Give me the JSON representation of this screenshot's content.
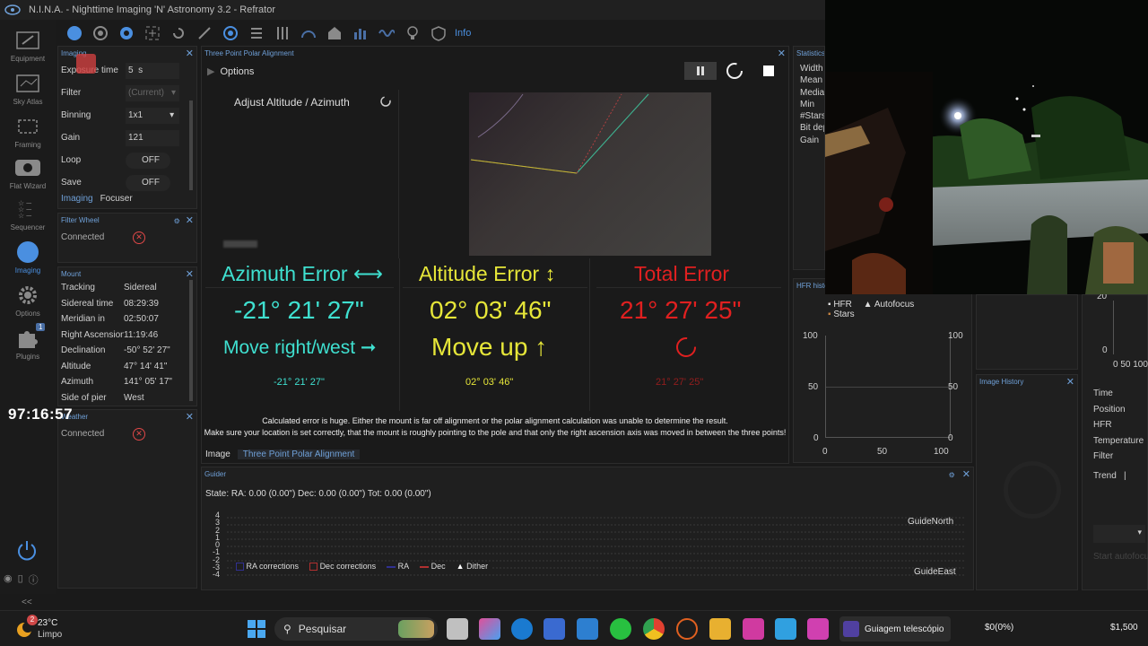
{
  "window": {
    "title": "N.I.N.A. - Nighttime Imaging 'N' Astronomy 3.2  -  Refrator"
  },
  "nav": [
    {
      "label": "Equipment"
    },
    {
      "label": "Sky Atlas"
    },
    {
      "label": "Framing"
    },
    {
      "label": "Flat Wizard"
    },
    {
      "label": "Sequencer"
    },
    {
      "label": "Imaging"
    },
    {
      "label": "Options"
    },
    {
      "label": "Plugins",
      "badge": "1"
    }
  ],
  "toolbar": {
    "info_label": "Info"
  },
  "imaging_panel": {
    "title": "Imaging",
    "rows": [
      {
        "label": "Exposure time",
        "value": "5",
        "unit": "s"
      },
      {
        "label": "Filter",
        "value": "(Current)"
      },
      {
        "label": "Binning",
        "value": "1x1"
      },
      {
        "label": "Gain",
        "value": "121"
      },
      {
        "label": "Loop",
        "value": "OFF"
      },
      {
        "label": "Save",
        "value": "OFF"
      }
    ],
    "tabs": [
      "Imaging",
      "Focuser"
    ]
  },
  "filter_wheel": {
    "title": "Filter Wheel",
    "status": "Connected"
  },
  "mount": {
    "title": "Mount",
    "rows": [
      {
        "k": "Tracking",
        "v": "Sidereal"
      },
      {
        "k": "Sidereal time",
        "v": "08:29:39"
      },
      {
        "k": "Meridian in",
        "v": "02:50:07"
      },
      {
        "k": "Right Ascension",
        "v": "11:19:46"
      },
      {
        "k": "Declination",
        "v": "-50° 52' 27\""
      },
      {
        "k": "Altitude",
        "v": "47° 14' 41\""
      },
      {
        "k": "Azimuth",
        "v": "141° 05' 17\""
      },
      {
        "k": "Side of pier",
        "v": "West"
      }
    ]
  },
  "weather": {
    "title": "Weather",
    "status": "Connected"
  },
  "timer": "97:16:57",
  "tppa": {
    "panel_title": "Three Point Polar Alignment",
    "options_label": "Options",
    "step_label": "Adjust Altitude / Azimuth",
    "azimuth": {
      "title": "Azimuth Error ⟷",
      "value": "-21° 21' 27\"",
      "move": "Move right/west ➞",
      "small": "-21° 21' 27\""
    },
    "altitude": {
      "title": "Altitude Error ↕",
      "value": "02° 03' 46\"",
      "move": "Move up ↑",
      "small": "02° 03' 46\""
    },
    "total": {
      "title": "Total Error",
      "value": "21° 27' 25\"",
      "small": "21° 27' 25\""
    },
    "message1": "Calculated error is huge. Either the mount is far off alignment or the polar alignment calculation was unable to determine the result.",
    "message2": "Make sure your location is set correctly, that the mount is roughly pointing to the pole and that only the right ascension axis was moved in between the three points!",
    "tabs": [
      "Image",
      "Three Point Polar Alignment"
    ]
  },
  "statistics": {
    "title": "Statistics",
    "labels": [
      "Width",
      "Mean",
      "Median",
      "Min",
      "#Stars",
      "Bit depth",
      "Gain"
    ]
  },
  "hfr_history": {
    "title": "HFR history",
    "legend": [
      "HFR",
      "Autofocus",
      "Stars"
    ],
    "y_ticks": [
      "100",
      "50",
      "0"
    ],
    "x_ticks": [
      "0",
      "50",
      "100"
    ]
  },
  "image_history": {
    "title": "Image History"
  },
  "right_stats": {
    "y_ticks": [
      "20",
      "0"
    ],
    "x_ticks": "0 50 100",
    "labels": [
      "Time",
      "Position",
      "HFR",
      "Temperature",
      "Filter"
    ],
    "trend_label": "Trend",
    "start_label": "Start autofocus"
  },
  "guider": {
    "title": "Guider",
    "state": "State:  RA: 0.00 (0.00\")  Dec: 0.00 (0.00\")  Tot: 0.00 (0.00\")",
    "y_ticks": [
      "4",
      "3",
      "2",
      "1",
      "0",
      "-1",
      "-2",
      "-3",
      "-4"
    ],
    "north": "GuideNorth",
    "east": "GuideEast",
    "legend": [
      "RA corrections",
      "Dec corrections",
      "RA",
      "Dec",
      "Dither"
    ]
  },
  "taskbar": {
    "weather_temp": "23°C",
    "weather_cond": "Limpo",
    "weather_badge": "2",
    "search_placeholder": "Pesquisar",
    "active_app": "Guiagem telescópio",
    "tray1": "$0(0%)",
    "tray2": "$1,500"
  },
  "colors": {
    "accent": "#4a8fe0",
    "cyan": "#3fe0d0",
    "yellow": "#e6e639",
    "red": "#e02020"
  }
}
